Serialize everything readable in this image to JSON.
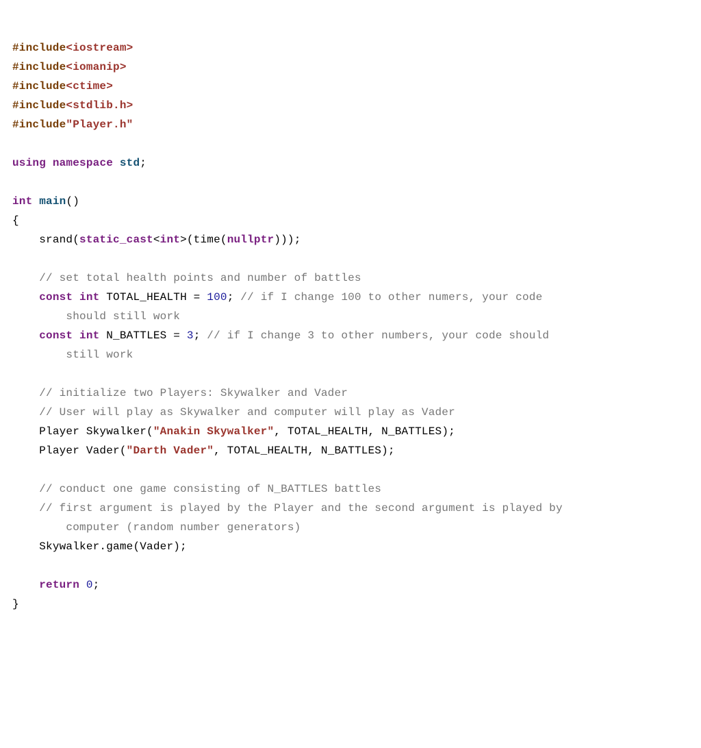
{
  "lines": {
    "0": {
      "t0": "#include",
      "t1": "<iostream>"
    },
    "1": {
      "t0": "#include",
      "t1": "<iomanip>"
    },
    "2": {
      "t0": "#include",
      "t1": "<ctime>"
    },
    "3": {
      "t0": "#include",
      "t1": "<stdlib.h>"
    },
    "4": {
      "t0": "#include",
      "t1": "\"Player.h\""
    },
    "5": {
      "t0": " "
    },
    "6": {
      "t0": "using",
      "t1": " ",
      "t2": "namespace",
      "t3": " ",
      "t4": "std",
      "t5": ";"
    },
    "7": {
      "t0": " "
    },
    "8": {
      "t0": "int",
      "t1": " ",
      "t2": "main",
      "t3": "()"
    },
    "9": {
      "t0": "{"
    },
    "10": {
      "t0": "    ",
      "t1": "srand(",
      "t2": "static_cast",
      "t3": "<",
      "t4": "int",
      "t5": ">(time(",
      "t6": "nullptr",
      "t7": ")));"
    },
    "11": {
      "t0": " "
    },
    "12": {
      "t0": "    ",
      "t1": "// set total health points and number of battles"
    },
    "13": {
      "t0": "    ",
      "t1": "const",
      "t2": " ",
      "t3": "int",
      "t4": " TOTAL_HEALTH = ",
      "t5": "100",
      "t6": "; ",
      "t7": "// if I change 100 to other numers, your code"
    },
    "14": {
      "t0": "        ",
      "t1": "should still work"
    },
    "15": {
      "t0": "    ",
      "t1": "const",
      "t2": " ",
      "t3": "int",
      "t4": " N_BATTLES = ",
      "t5": "3",
      "t6": "; ",
      "t7": "// if I change 3 to other numbers, your code should"
    },
    "16": {
      "t0": "        ",
      "t1": "still work"
    },
    "17": {
      "t0": " "
    },
    "18": {
      "t0": "    ",
      "t1": "// initialize two Players: Skywalker and Vader"
    },
    "19": {
      "t0": "    ",
      "t1": "// User will play as Skywalker and computer will play as Vader"
    },
    "20": {
      "t0": "    ",
      "t1": "Player Skywalker(",
      "t2": "\"Anakin Skywalker\"",
      "t3": ", TOTAL_HEALTH, N_BATTLES);"
    },
    "21": {
      "t0": "    ",
      "t1": "Player Vader(",
      "t2": "\"Darth Vader\"",
      "t3": ", TOTAL_HEALTH, N_BATTLES);"
    },
    "22": {
      "t0": " "
    },
    "23": {
      "t0": "    ",
      "t1": "// conduct one game consisting of N_BATTLES battles"
    },
    "24": {
      "t0": "    ",
      "t1": "// first argument is played by the Player and the second argument is played by"
    },
    "25": {
      "t0": "        ",
      "t1": "computer (random number generators)"
    },
    "26": {
      "t0": "    ",
      "t1": "Skywalker.game(Vader);"
    },
    "27": {
      "t0": " "
    },
    "28": {
      "t0": "    ",
      "t1": "return",
      "t2": " ",
      "t3": "0",
      "t4": ";"
    },
    "29": {
      "t0": "}"
    }
  }
}
